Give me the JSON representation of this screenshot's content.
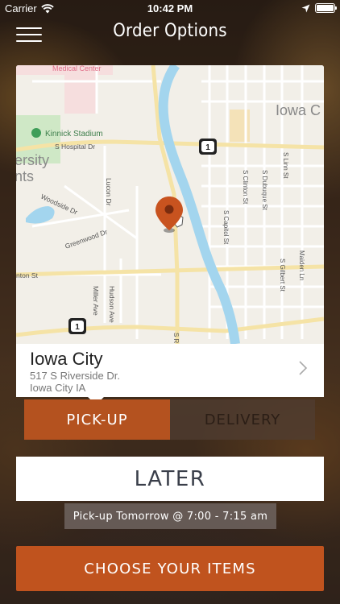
{
  "status_bar": {
    "carrier": "Carrier",
    "time": "10:42 PM",
    "battery_level": 1.0
  },
  "header": {
    "title": "Order Options",
    "menu_icon": "hamburger-menu-icon"
  },
  "map": {
    "labels": {
      "medical_center": "Medical Center",
      "kinnick": "Kinnick Stadium",
      "hospital_dr": "S Hospital Dr",
      "iowa_city": "Iowa C",
      "university_1": "ersity",
      "university_2": "nts",
      "lucon_dr": "Lucon Dr",
      "woodside": "Woodside Dr",
      "greenwood": "Greenwood Dr",
      "benton": "nton St",
      "miller_ave": "Miller Ave",
      "hudson_ave": "Hudson Ave",
      "capitol_st": "S Capitol St",
      "clinton_st": "S Clinton St",
      "dubuque_st": "S Dubuque St",
      "linn_st": "S Linn St",
      "gilbert_st": "S Gilbert St",
      "maiden_ln": "Maiden Ln",
      "riverside": "S R",
      "highway_shield": "1"
    },
    "colors": {
      "river": "#a3d5ee",
      "pin": "#c8531f",
      "park": "#c8e6c0",
      "hospital": "#f6d9d9",
      "road_major": "#f7e7b0"
    }
  },
  "location": {
    "name": "Iowa City",
    "address_line1": "517 S Riverside Dr.",
    "address_line2": "Iowa City IA"
  },
  "order_type": {
    "pickup_label": "PICK-UP",
    "delivery_label": "DELIVERY",
    "selected": "pickup"
  },
  "timing": {
    "later_label": "LATER",
    "pickup_time_text": "Pick-up Tomorrow @ 7:00 - 7:15 am"
  },
  "actions": {
    "choose_items_label": "CHOOSE YOUR ITEMS"
  },
  "accent_colors": {
    "primary": "#c0531e",
    "pickup_selected": "#b4521f"
  }
}
